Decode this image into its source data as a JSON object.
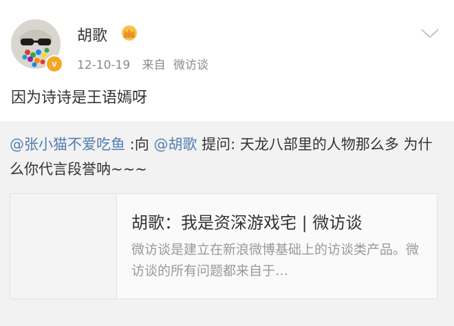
{
  "post": {
    "author": "胡歌",
    "date": "12-10-19",
    "source_prefix": "来自",
    "source_app": "微访谈",
    "text": "因为诗诗是王语嫣呀",
    "verified_mark": "v"
  },
  "repost": {
    "asker_mention": "@张小猫不爱吃鱼",
    "to_label": " :向 ",
    "target_mention": "@胡歌",
    "ask_label": " 提问: ",
    "question": "天龙八部里的人物那么多 为什么你代言段誉呐~~~"
  },
  "card": {
    "title": "胡歌：我是资深游戏宅 | 微访谈",
    "description": "微访谈是建立在新浪微博基础上的访谈类产品。微访谈的所有问题都来自于…"
  },
  "colors": {
    "mention": "#507daf",
    "verified_badge": "#f5a623",
    "repost_background": "#f2f2f2"
  },
  "icons": {
    "vip": "crown-icon",
    "menu": "chevron-down-icon",
    "verified": "verified-badge-icon"
  }
}
